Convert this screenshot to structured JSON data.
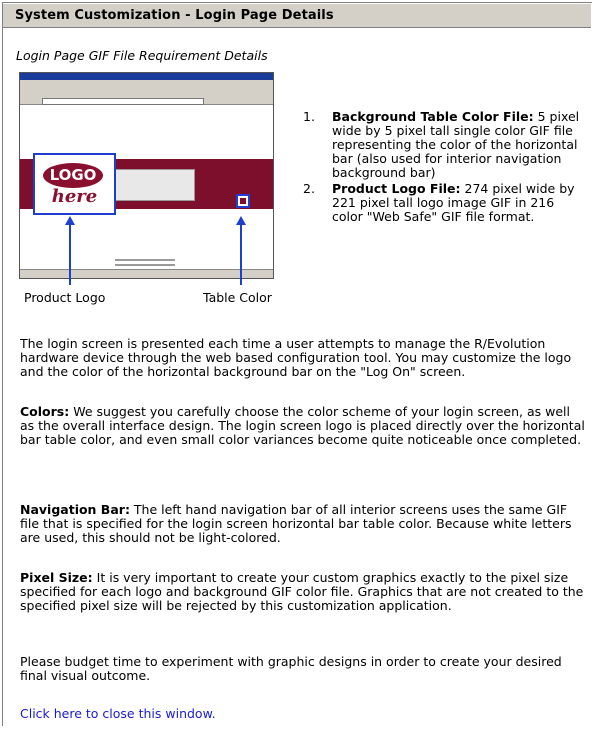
{
  "header": {
    "title": "System Customization - Login Page Details"
  },
  "subtitle": "Login Page GIF File Requirement Details",
  "illustration": {
    "logo_text": "LOGO",
    "logo_sub": "here",
    "caption_logo": "Product Logo",
    "caption_color": "Table Color"
  },
  "requirements": [
    {
      "number": "1.",
      "title": "Background Table Color File:",
      "text": "5 pixel wide by 5 pixel tall single color GIF file representing the color of the horizontal bar (also used for interior navigation background bar)"
    },
    {
      "number": "2.",
      "title": "Product Logo File:",
      "text": "274 pixel wide by 221 pixel tall logo image GIF in 216 color \"Web Safe\" GIF file format."
    }
  ],
  "intro": "The login screen is presented each time a user attempts to manage the R/Evolution hardware device through the web based configuration tool. You may customize the logo and the color of the horizontal background bar on the \"Log On\" screen.",
  "sections": [
    {
      "title": "Colors:",
      "text": "We suggest you carefully choose the color scheme of your login screen, as well as the overall interface design. The login screen logo is placed directly over the horizontal bar table color, and even small color variances become quite noticeable once completed."
    },
    {
      "title": "Navigation Bar:",
      "text": "The left hand navigation bar of all interior screens uses the same GIF file that is specified for the login screen horizontal bar table color. Because white letters are used, this should not be light-colored."
    },
    {
      "title": "Pixel Size:",
      "text": "It is very important to create your custom graphics exactly to the pixel size specified for each logo and background GIF color file. Graphics that are not created to the specified pixel size will be rejected by this customization application."
    }
  ],
  "closing": "Please budget time to experiment with graphic designs in order to create your desired final visual outcome.",
  "close_link": "Click here to close this window.",
  "colors": {
    "bar": "#7d0e2c",
    "accent": "#1f3fd0",
    "link": "#1a1ad0"
  }
}
